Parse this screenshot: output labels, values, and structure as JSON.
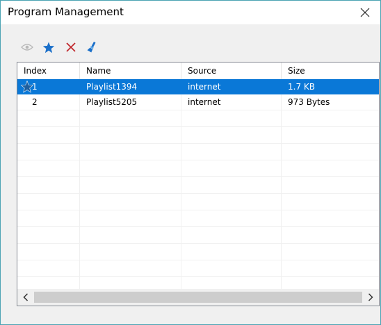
{
  "window": {
    "title": "Program Management"
  },
  "toolbar": {
    "icons": [
      "eye-icon",
      "star-icon",
      "delete-icon",
      "clear-icon"
    ]
  },
  "table": {
    "columns": [
      "Index",
      "Name",
      "Source",
      "Size"
    ],
    "rows": [
      {
        "index": "1",
        "name": "Playlist1394",
        "source": "internet",
        "size": "1.7 KB",
        "selected": true,
        "starred": true
      },
      {
        "index": "2",
        "name": "Playlist5205",
        "source": "internet",
        "size": "973 Bytes",
        "selected": false,
        "starred": false
      }
    ]
  },
  "colors": {
    "selection": "#0a78d7",
    "star": "#1a6fc9",
    "delete": "#c0282d",
    "border": "#4aa3b3"
  }
}
